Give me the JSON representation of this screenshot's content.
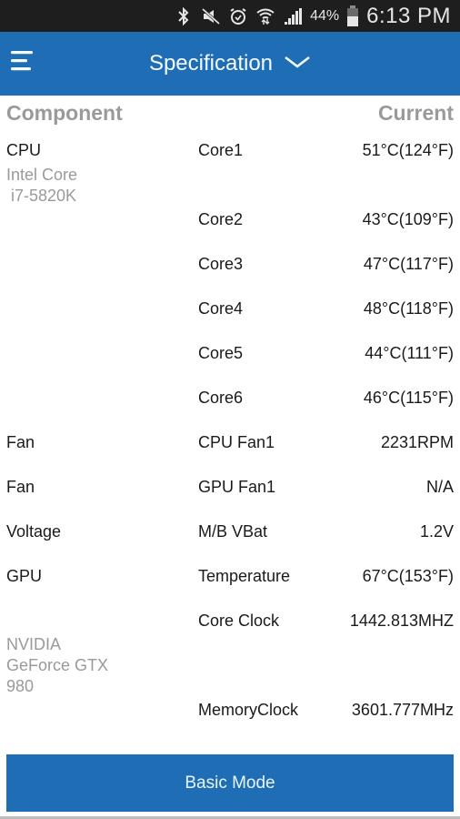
{
  "status_bar": {
    "icons": [
      "bluetooth-icon",
      "mute-icon",
      "alarm-icon",
      "wifi-icon",
      "signal-icon",
      "battery-icon"
    ],
    "battery_percent": "44%",
    "time": "6:13 PM"
  },
  "app_bar": {
    "title": "Specification",
    "menu_icon": "hamburger-menu-icon",
    "dropdown_icon": "chevron-down-icon",
    "color": "#1f6db5"
  },
  "table": {
    "headers": {
      "component": "Component",
      "current": "Current"
    },
    "rows": [
      {
        "component": "CPU",
        "sensor": "Core1",
        "value": "51°C(124°F)"
      },
      {
        "component": "",
        "sensor": "Core2",
        "value": "43°C(109°F)"
      },
      {
        "component": "",
        "sensor": "Core3",
        "value": "47°C(117°F)"
      },
      {
        "component": "",
        "sensor": "Core4",
        "value": "48°C(118°F)"
      },
      {
        "component": "",
        "sensor": "Core5",
        "value": "44°C(111°F)"
      },
      {
        "component": "",
        "sensor": "Core6",
        "value": "46°C(115°F)"
      },
      {
        "component": "Fan",
        "sensor": "CPU Fan1",
        "value": "2231RPM"
      },
      {
        "component": "Fan",
        "sensor": "GPU Fan1",
        "value": "N/A"
      },
      {
        "component": "Voltage",
        "sensor": "M/B VBat",
        "value": "1.2V"
      },
      {
        "component": "GPU",
        "sensor": "Temperature",
        "value": "67°C(153°F)"
      },
      {
        "component": "",
        "sensor": "Core Clock",
        "value": "1442.813MHZ"
      },
      {
        "component": "",
        "sensor": "MemoryClock",
        "value": "3601.777MHz"
      }
    ],
    "cpu_model": "Intel Core\n i7-5820K",
    "gpu_model": "NVIDIA\nGeForce GTX\n980"
  },
  "footer": {
    "basic_mode_label": "Basic Mode"
  }
}
